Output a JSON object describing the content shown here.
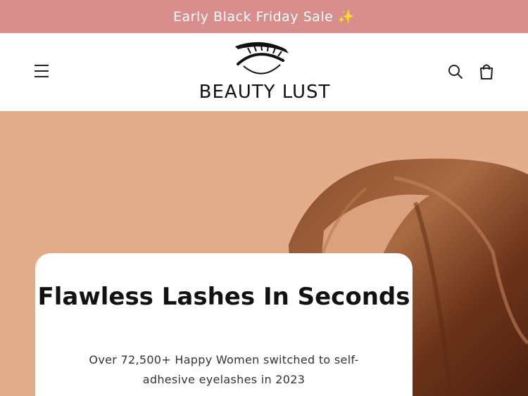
{
  "announcement": {
    "text": "Early Black Friday Sale ✨"
  },
  "header": {
    "logo_text": "BEAUTY LUST",
    "menu_icon": "hamburger-menu-icon",
    "search_icon": "search-icon",
    "cart_icon": "shopping-bag-icon"
  },
  "hero": {
    "title": "Flawless Lashes In Seconds",
    "subtitle": "Over 72,500+ Happy Women switched to self-adhesive eyelashes in 2023"
  },
  "colors": {
    "announcement_bg": "#d98e8e",
    "hero_bg": "#e3ad8c",
    "hair": "#7a3f22"
  }
}
